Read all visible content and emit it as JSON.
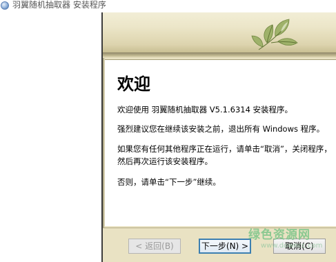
{
  "window": {
    "title": "羽翼随机抽取器 安装程序",
    "icon": "installer-disc-icon"
  },
  "header": {
    "logo": "leaf-logo-icon"
  },
  "content": {
    "heading": "欢迎",
    "para1": "欢迎使用 羽翼随机抽取器 V5.1.6314 安装程序。",
    "para2": "强烈建议您在继续该安装之前，退出所有 Windows 程序。",
    "para3": "如果您有任何其他程序正在运行，请单击“取消”，关闭程序，然后再次运行该安装程序。",
    "para4": "否则，请单击“下一步”继续。"
  },
  "buttons": {
    "back_label": "< 返回(B)",
    "next_label": "下一步(N) >",
    "cancel_label": "取消(C)"
  },
  "watermark": {
    "main": "绿色资源网",
    "sub": "www.downcc.com"
  },
  "colors": {
    "beige": "#e9e2c3",
    "focus_border": "#3c7fb1",
    "leaf_green": "#8ea65a"
  }
}
